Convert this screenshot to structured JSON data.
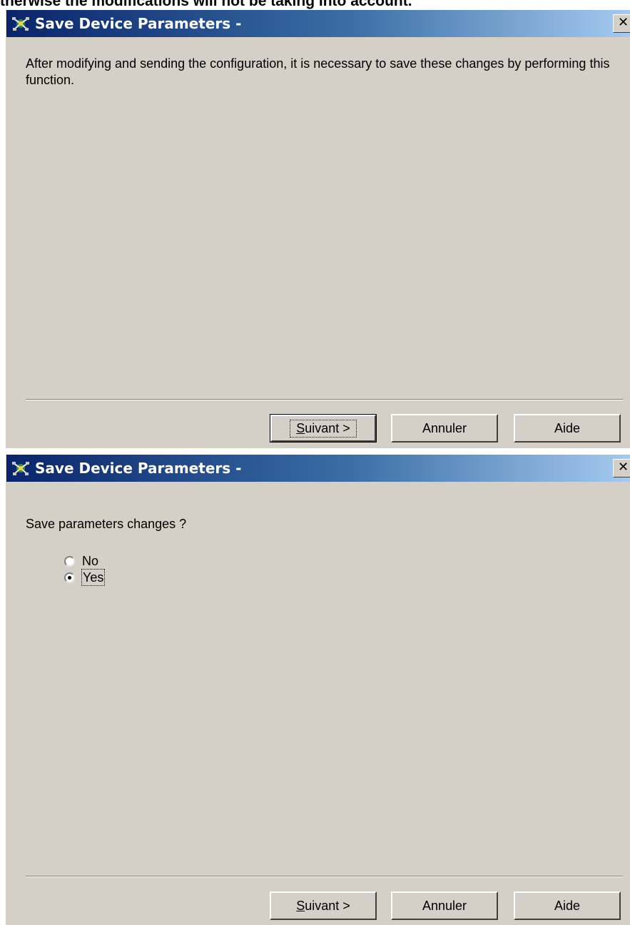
{
  "top_note": "therwise the modifications will not be taking into account.",
  "dialog1": {
    "title": "Save Device Parameters -",
    "body_text": "After modifying and sending the configuration, it is necessary to save these changes by performing this function.",
    "buttons": {
      "next_accel": "S",
      "next_rest": "uivant >",
      "cancel": "Annuler",
      "help": "Aide"
    }
  },
  "dialog2": {
    "title": "Save Device Parameters -",
    "question": "Save parameters changes ?",
    "options": [
      {
        "label": "No",
        "selected": false
      },
      {
        "label": "Yes",
        "selected": true
      }
    ],
    "buttons": {
      "next_accel": "S",
      "next_rest": "uivant >",
      "cancel": "Annuler",
      "help": "Aide"
    }
  },
  "icons": {
    "app": "network-device-icon",
    "close": "close-icon",
    "close_glyph": "✕"
  },
  "colors": {
    "dialog_bg": "#d4d0c8",
    "title_start": "#0a246a",
    "title_end": "#a6caf0"
  }
}
